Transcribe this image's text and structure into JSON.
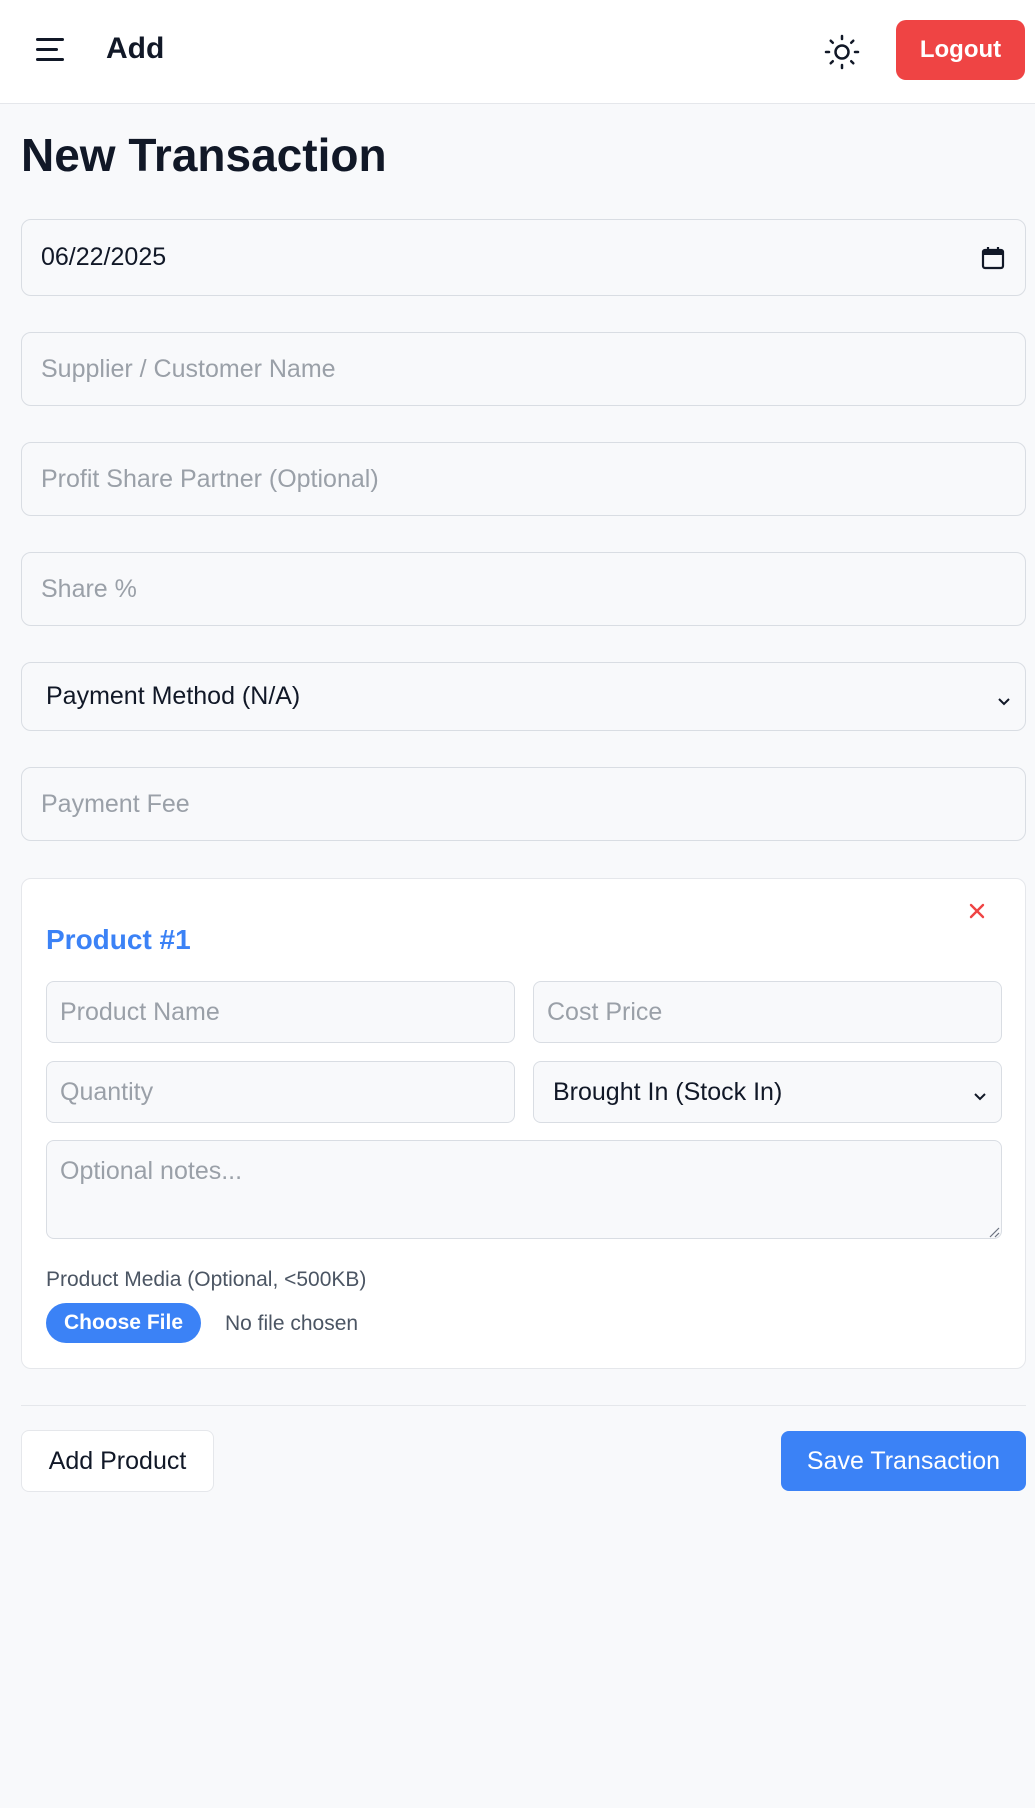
{
  "header": {
    "menu_icon": "hamburger-menu-icon",
    "title": "Add",
    "theme_icon": "sun-icon",
    "logout_label": "Logout",
    "logout_color": "#ef4444"
  },
  "page": {
    "title": "New Transaction"
  },
  "form": {
    "date_value": "06/22/2025",
    "date_icon": "calendar-icon",
    "supplier_placeholder": "Supplier / Customer Name",
    "partner_placeholder": "Profit Share Partner (Optional)",
    "share_placeholder": "Share %",
    "payment_method_selected": "Payment Method (N/A)",
    "payment_fee_placeholder": "Payment Fee"
  },
  "product": {
    "title": "Product #1",
    "title_color": "#3b82f6",
    "remove_icon": "close-icon",
    "name_placeholder": "Product Name",
    "cost_placeholder": "Cost Price",
    "quantity_placeholder": "Quantity",
    "direction_selected": "Brought In (Stock In)",
    "notes_placeholder": "Optional notes...",
    "media_label": "Product Media (Optional, <500KB)",
    "choose_file_label": "Choose File",
    "no_file_text": "No file chosen"
  },
  "actions": {
    "add_product_label": "Add Product",
    "save_label": "Save Transaction",
    "accent_color": "#3b82f6"
  }
}
